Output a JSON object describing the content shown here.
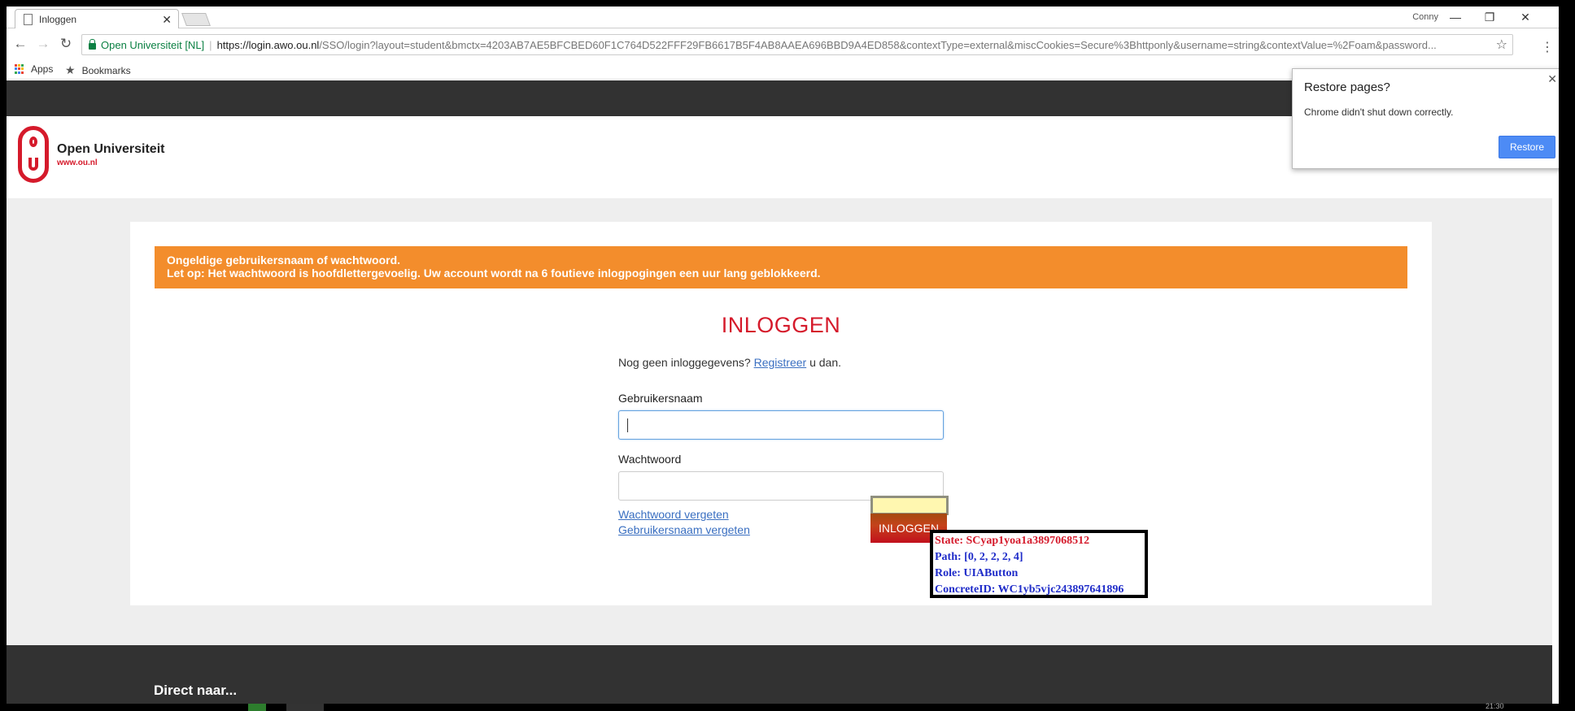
{
  "browser": {
    "tab_title": "Inloggen",
    "user": "Conny",
    "secure_label": "Open Universiteit [NL]",
    "url_host": "https://login.awo.ou.nl",
    "url_path": "/SSO/login?layout=student&bmctx=4203AB7AE5BFCBED60F1C764D522FFF29FB6617B5F4AB8AAEA696BBD9A4ED858&contextType=external&miscCookies=Secure%3Bhttponly&username=string&contextValue=%2Foam&password...",
    "bookmarks": {
      "apps": "Apps",
      "bookmarks": "Bookmarks"
    }
  },
  "popup": {
    "title": "Restore pages?",
    "text": "Chrome didn't shut down correctly.",
    "button": "Restore"
  },
  "header": {
    "logo_name": "Open Universiteit",
    "logo_url": "www.ou.nl"
  },
  "alert": {
    "line1": "Ongeldige gebruikersnaam of wachtwoord.",
    "line2": "Let op: Het wachtwoord is hoofdlettergevoelig. Uw account wordt na 6 foutieve inlogpogingen een uur lang geblokkeerd."
  },
  "form": {
    "title": "INLOGGEN",
    "register_prefix": "Nog geen inloggegevens?",
    "register_link": "Registreer",
    "register_suffix": "u dan.",
    "username_label": "Gebruikersnaam",
    "password_label": "Wachtwoord",
    "forgot_password": "Wachtwoord vergeten",
    "forgot_username": "Gebruikersnaam vergeten",
    "login_button": "INLOGGEN"
  },
  "inspector": {
    "state": "State: SCyap1yoa1a3897068512",
    "path": "Path: [0, 2, 2, 2, 4]",
    "role": "Role: UIAButton",
    "concrete_id": "ConcreteID: WC1yb5vjc243897641896"
  },
  "footer": {
    "title": "Direct naar..."
  },
  "taskbar": {
    "clock": "21:30"
  },
  "colors": {
    "brand": "#d51a2b",
    "alert": "#f38d2c",
    "link": "#3a6fc1",
    "restore": "#4d8bf5"
  }
}
